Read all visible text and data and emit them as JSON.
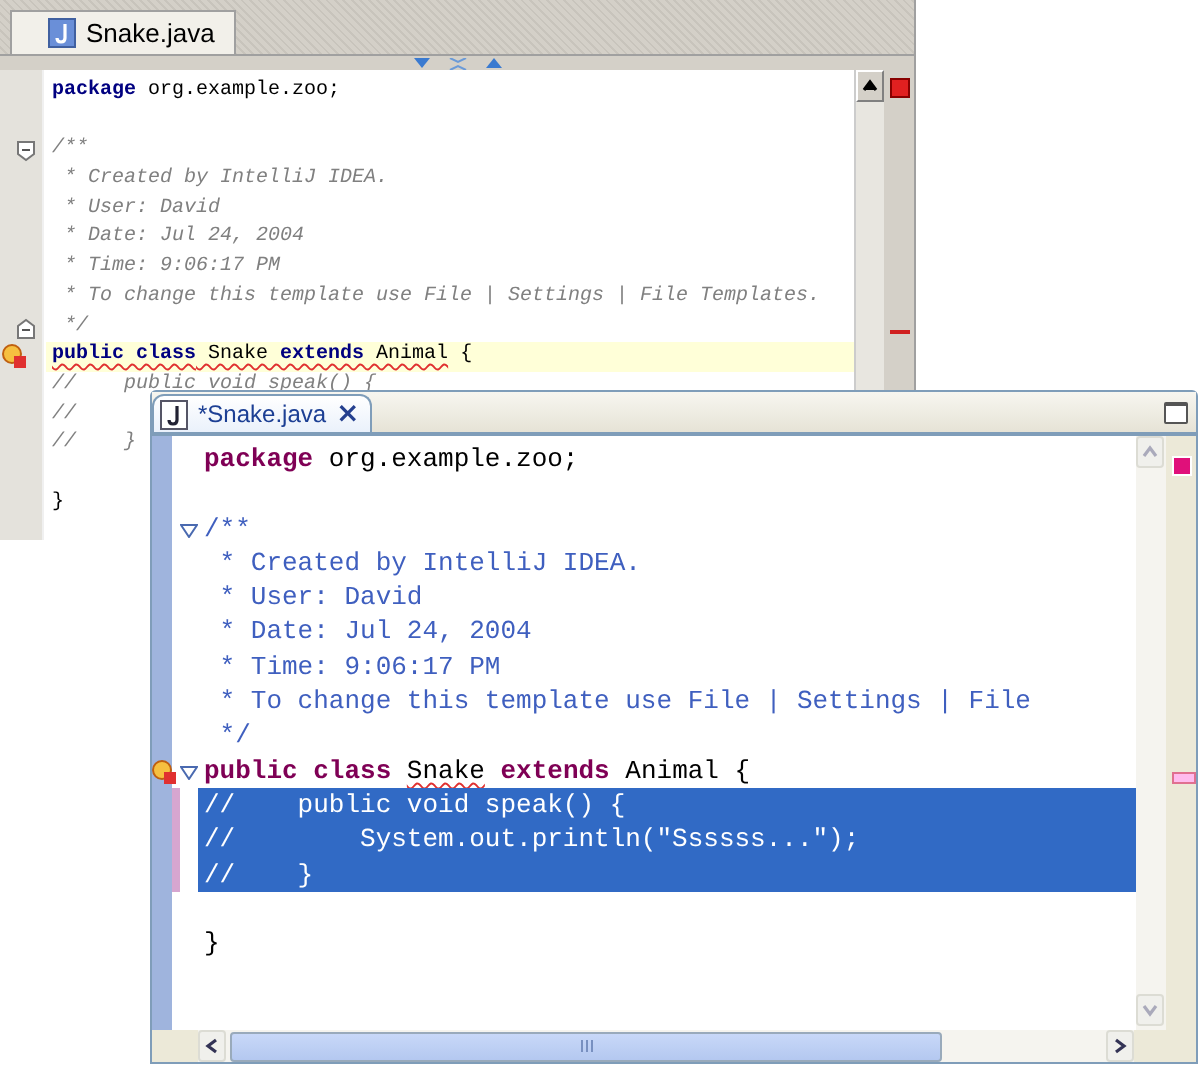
{
  "editors": [
    {
      "kind": "classic",
      "tab": {
        "label": "Snake.java"
      },
      "lines": [
        {
          "kind": "code",
          "tokens": [
            {
              "text": "package",
              "kind": "keyword"
            },
            {
              "text": " org.example.zoo;",
              "kind": "plain"
            }
          ]
        },
        {
          "kind": "blank"
        },
        {
          "kind": "code",
          "fold_start": true,
          "tokens": [
            {
              "text": "/**",
              "kind": "comment"
            }
          ]
        },
        {
          "kind": "code",
          "tokens": [
            {
              "text": " * Created by IntelliJ IDEA.",
              "kind": "comment"
            }
          ]
        },
        {
          "kind": "code",
          "tokens": [
            {
              "text": " * User: David",
              "kind": "comment"
            }
          ]
        },
        {
          "kind": "code",
          "tokens": [
            {
              "text": " * Date: Jul 24, 2004",
              "kind": "comment"
            }
          ]
        },
        {
          "kind": "code",
          "tokens": [
            {
              "text": " * Time: 9:06:17 PM",
              "kind": "comment"
            }
          ]
        },
        {
          "kind": "code",
          "tokens": [
            {
              "text": " * To change this template use File | Settings | File Templates.",
              "kind": "comment"
            }
          ]
        },
        {
          "kind": "code",
          "fold_end": true,
          "tokens": [
            {
              "text": " */",
              "kind": "comment"
            }
          ]
        },
        {
          "kind": "code",
          "highlighted": true,
          "error": true,
          "tokens": [
            {
              "text": "public class",
              "kind": "keyword",
              "squiggle": true
            },
            {
              "text": " Snake ",
              "kind": "plain",
              "squiggle": true
            },
            {
              "text": "extends",
              "kind": "keyword",
              "squiggle": true
            },
            {
              "text": " Animal",
              "kind": "plain",
              "squiggle": true
            },
            {
              "text": " {",
              "kind": "plain"
            }
          ]
        },
        {
          "kind": "code",
          "tokens": [
            {
              "text": "//    public void speak() {",
              "kind": "comment"
            }
          ]
        },
        {
          "kind": "code",
          "tokens": [
            {
              "text": "//",
              "kind": "comment"
            }
          ]
        },
        {
          "kind": "code",
          "tokens": [
            {
              "text": "//    }",
              "kind": "comment"
            }
          ]
        },
        {
          "kind": "blank"
        },
        {
          "kind": "code",
          "tokens": [
            {
              "text": "}",
              "kind": "plain"
            }
          ]
        }
      ]
    },
    {
      "kind": "xp",
      "tab": {
        "label": "*Snake.java",
        "close": "×"
      },
      "lines": [
        {
          "kind": "code",
          "tokens": [
            {
              "text": "package",
              "kind": "keyword"
            },
            {
              "text": " org.example.zoo;",
              "kind": "plain"
            }
          ]
        },
        {
          "kind": "blank"
        },
        {
          "kind": "code",
          "fold_start": true,
          "tokens": [
            {
              "text": "/**",
              "kind": "comment"
            }
          ]
        },
        {
          "kind": "code",
          "tokens": [
            {
              "text": " * Created by IntelliJ IDEA.",
              "kind": "comment"
            }
          ]
        },
        {
          "kind": "code",
          "tokens": [
            {
              "text": " * User: David",
              "kind": "comment"
            }
          ]
        },
        {
          "kind": "code",
          "tokens": [
            {
              "text": " * Date: Jul 24, 2004",
              "kind": "comment"
            }
          ]
        },
        {
          "kind": "code",
          "tokens": [
            {
              "text": " * Time: 9:06:17 PM",
              "kind": "comment"
            }
          ]
        },
        {
          "kind": "code",
          "tokens": [
            {
              "text": " * To change this template use File | Settings | File",
              "kind": "comment"
            }
          ]
        },
        {
          "kind": "code",
          "tokens": [
            {
              "text": " */",
              "kind": "comment"
            }
          ]
        },
        {
          "kind": "code",
          "fold_start": true,
          "error": true,
          "tokens": [
            {
              "text": "public class ",
              "kind": "keyword"
            },
            {
              "text": "Snake",
              "kind": "plain",
              "squiggle": true
            },
            {
              "text": " extends",
              "kind": "keyword"
            },
            {
              "text": " Animal {",
              "kind": "plain"
            }
          ]
        },
        {
          "kind": "code",
          "selected": true,
          "tokens": [
            {
              "text": "//    public void speak() {",
              "kind": "comment"
            }
          ]
        },
        {
          "kind": "code",
          "selected": true,
          "tokens": [
            {
              "text": "//        System.out.println(\"Ssssss...\");",
              "kind": "comment"
            }
          ]
        },
        {
          "kind": "code",
          "selected": true,
          "tokens": [
            {
              "text": "//    }",
              "kind": "comment"
            }
          ]
        },
        {
          "kind": "blank"
        },
        {
          "kind": "code",
          "tokens": [
            {
              "text": "}",
              "kind": "plain"
            }
          ]
        }
      ]
    }
  ]
}
